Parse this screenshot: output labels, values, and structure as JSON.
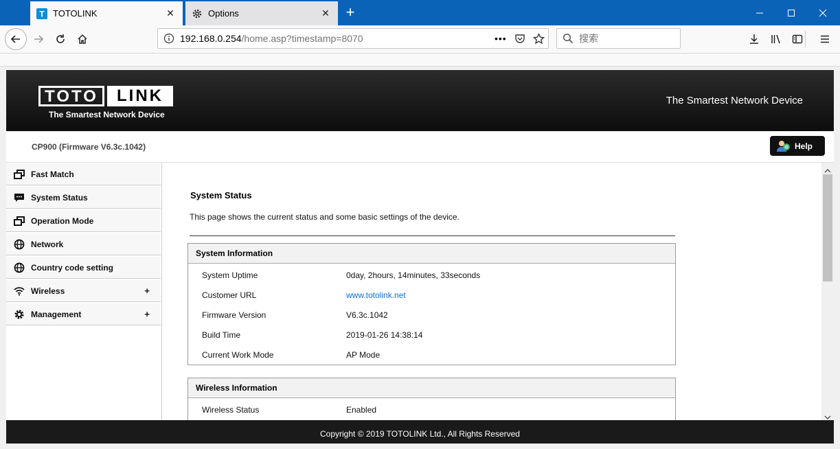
{
  "browser": {
    "tabs": [
      {
        "label": "TOTOLINK",
        "active": true
      },
      {
        "label": "Options",
        "active": false
      }
    ],
    "url_host": "192.168.0.254",
    "url_path": "/home.asp?timestamp=8070",
    "search_placeholder": "搜索"
  },
  "header": {
    "logo_left": "TOTO",
    "logo_right": "LINK",
    "logo_tagline": "The Smartest Network Device",
    "tagline_right": "The Smartest Network Device"
  },
  "infobar": {
    "model": "CP900 (Firmware V6.3c.1042)",
    "help_label": "Help"
  },
  "sidebar": {
    "items": [
      {
        "label": "Fast Match",
        "icon": "window-icon",
        "expandable": false
      },
      {
        "label": "System Status",
        "icon": "chat-icon",
        "expandable": false
      },
      {
        "label": "Operation Mode",
        "icon": "window-icon",
        "expandable": false
      },
      {
        "label": "Network",
        "icon": "globe-icon",
        "expandable": false
      },
      {
        "label": "Country code setting",
        "icon": "globe-icon",
        "expandable": false
      },
      {
        "label": "Wireless",
        "icon": "wifi-icon",
        "expandable": true
      },
      {
        "label": "Management",
        "icon": "gear-icon",
        "expandable": true
      }
    ],
    "expand_symbol": "+"
  },
  "content": {
    "title": "System Status",
    "description": "This page shows the current status and some basic settings of the device.",
    "system_info": {
      "heading": "System Information",
      "rows": [
        {
          "label": "System Uptime",
          "value": "0day, 2hours, 14minutes, 33seconds"
        },
        {
          "label": "Customer URL",
          "value": "www.totolink.net"
        },
        {
          "label": "Firmware Version",
          "value": "V6.3c.1042"
        },
        {
          "label": "Build Time",
          "value": "2019-01-26 14:38:14"
        },
        {
          "label": "Current Work Mode",
          "value": "AP Mode"
        }
      ]
    },
    "wireless_info": {
      "heading": "Wireless Information",
      "rows": [
        {
          "label": "Wireless Status",
          "value": "Enabled"
        }
      ]
    }
  },
  "footer": {
    "copyright": "Copyright © 2019 TOTOLINK Ltd., All Rights Reserved"
  }
}
